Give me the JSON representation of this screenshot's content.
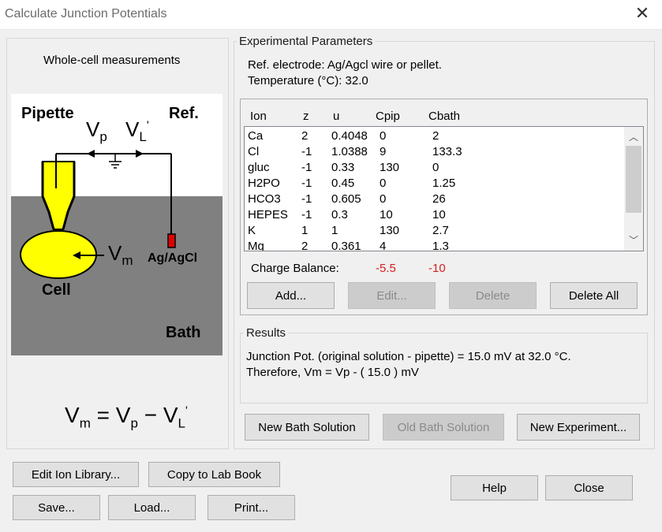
{
  "window": {
    "title": "Calculate Junction Potentials"
  },
  "diagram": {
    "heading": "Whole-cell measurements",
    "pipette_label": "Pipette",
    "ref_label": "Ref.",
    "vp_label": "V",
    "vp_sub": "p",
    "vl_label": "V",
    "vl_sub": "L",
    "vl_prime": "'",
    "vm_label": "V",
    "vm_sub": "m",
    "electrode_label": "Ag/AgCl",
    "cell_label": "Cell",
    "bath_label": "Bath",
    "equation": {
      "lhs": "V",
      "lhs_sub": "m",
      "eq": "=",
      "t1": "V",
      "t1_sub": "p",
      "minus": "−",
      "t2": "V",
      "t2_sub": "L",
      "t2_prime": "'"
    },
    "colors": {
      "bath": "#808080",
      "cell": "#ffff00",
      "electrode": "#e00000"
    }
  },
  "experimental": {
    "caption": "Experimental Parameters",
    "ref_electrode": "Ref. electrode: Ag/Agcl wire or pellet.",
    "temperature": "Temperature (°C): 32.0",
    "columns": {
      "ion": "Ion",
      "z": "z",
      "u": "u",
      "cpip": "Cpip",
      "cbath": "Cbath"
    },
    "ions": [
      {
        "ion": "Ca",
        "z": "2",
        "u": "0.4048",
        "cpip": "0",
        "cbath": "2"
      },
      {
        "ion": "Cl",
        "z": "-1",
        "u": "1.0388",
        "cpip": "9",
        "cbath": "133.3"
      },
      {
        "ion": "gluc",
        "z": "-1",
        "u": "0.33",
        "cpip": "130",
        "cbath": "0"
      },
      {
        "ion": "H2PO",
        "z": "-1",
        "u": "0.45",
        "cpip": "0",
        "cbath": "1.25"
      },
      {
        "ion": "HCO3",
        "z": "-1",
        "u": "0.605",
        "cpip": "0",
        "cbath": "26"
      },
      {
        "ion": "HEPES",
        "z": "-1",
        "u": "0.3",
        "cpip": "10",
        "cbath": "10"
      },
      {
        "ion": "K",
        "z": "1",
        "u": "1",
        "cpip": "130",
        "cbath": "2.7"
      },
      {
        "ion": "Mg",
        "z": "2",
        "u": "0.361",
        "cpip": "4",
        "cbath": "1.3"
      }
    ],
    "charge_balance_label": "Charge Balance:",
    "charge_balance_pip": "-5.5",
    "charge_balance_bath": "-10",
    "buttons": {
      "add": "Add...",
      "edit": "Edit...",
      "delete": "Delete",
      "delete_all": "Delete All"
    }
  },
  "results": {
    "caption": "Results",
    "line1": "Junction Pot. (original solution - pipette) = 15.0 mV at 32.0 °C.",
    "line2": "Therefore, Vm = Vp - ( 15.0 ) mV"
  },
  "solution_buttons": {
    "new_bath": "New Bath Solution",
    "old_bath": "Old Bath Solution",
    "new_experiment": "New Experiment..."
  },
  "bottom_buttons": {
    "edit_ion_library": "Edit Ion Library...",
    "copy_lab_book": "Copy to Lab Book",
    "save": "Save...",
    "load": "Load...",
    "print": "Print...",
    "help": "Help",
    "close": "Close"
  },
  "icons": {
    "close": "close-icon",
    "scroll_up": "chevron-up-icon",
    "scroll_down": "chevron-down-icon"
  }
}
